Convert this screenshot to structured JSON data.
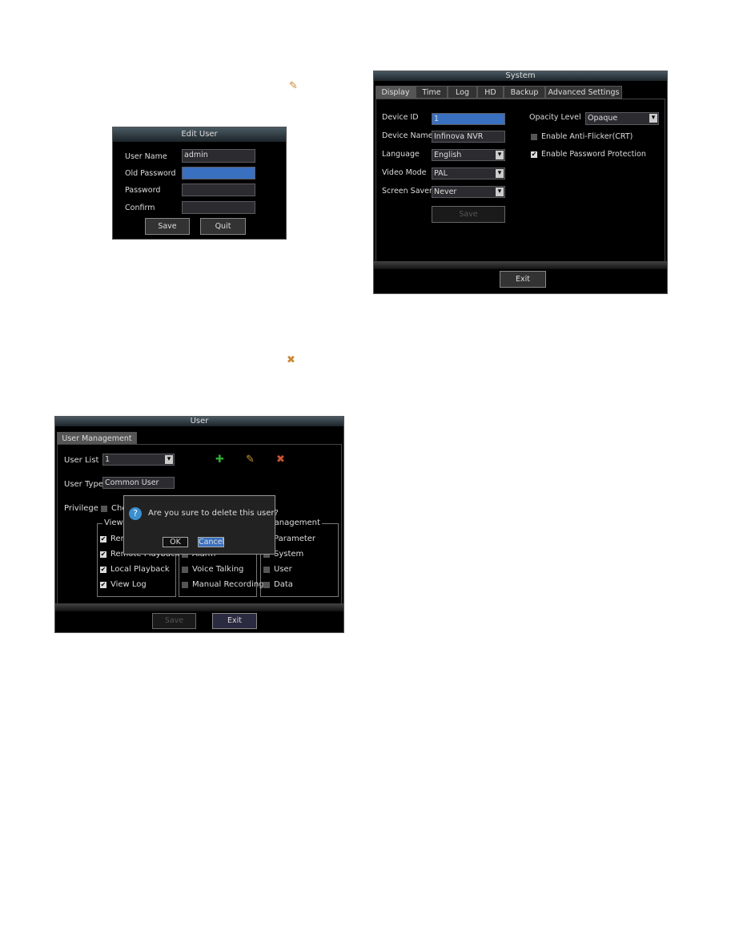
{
  "icons": {
    "edit_user": "user-edit-icon",
    "delete_user": "user-delete-icon",
    "add_user": "user-add-icon",
    "question": "question-icon"
  },
  "edit_user": {
    "title": "Edit User",
    "fields": [
      {
        "label": "User Name",
        "value": "admin"
      },
      {
        "label": "Old Password",
        "value": ""
      },
      {
        "label": "Password",
        "value": ""
      },
      {
        "label": "Confirm",
        "value": ""
      }
    ],
    "save": "Save",
    "quit": "Quit"
  },
  "system": {
    "title": "System",
    "tabs": [
      "Display",
      "Time",
      "Log",
      "HD",
      "Backup",
      "Advanced Settings"
    ],
    "fields": [
      {
        "label": "Device ID",
        "value": "1"
      },
      {
        "label": "Device Name",
        "value": "Infinova NVR"
      },
      {
        "label": "Language",
        "value": "English"
      },
      {
        "label": "Video Mode",
        "value": "PAL"
      },
      {
        "label": "Screen Saver",
        "value": "Never"
      }
    ],
    "save": "Save",
    "opacity_label": "Opacity Level",
    "opacity_value": "Opaque",
    "anti_flicker": "Enable Anti-Flicker(CRT)",
    "anti_flicker_checked": false,
    "password_protection": "Enable Password Protection",
    "password_protection_checked": true,
    "exit": "Exit"
  },
  "user": {
    "title": "User",
    "tab": "User Management",
    "user_list_label": "User List",
    "user_list_value": "1",
    "user_type_label": "User Type",
    "user_type_value": "Common User",
    "privilege_label": "Privilege",
    "privilege_check": "Che",
    "view_group": "View",
    "view_items": [
      "Rem",
      "Remote Playback",
      "Local Playback",
      "View Log"
    ],
    "mid_items": [
      "",
      "Alarm",
      "Voice Talking",
      "Manual Recording"
    ],
    "mgmt_group": "Management",
    "mgmt_items": [
      "Parameter",
      "System",
      "User",
      "Data"
    ],
    "dialog_text": "Are you sure to delete this user?",
    "ok": "OK",
    "cancel": "Cancel",
    "save": "Save",
    "exit": "Exit"
  }
}
